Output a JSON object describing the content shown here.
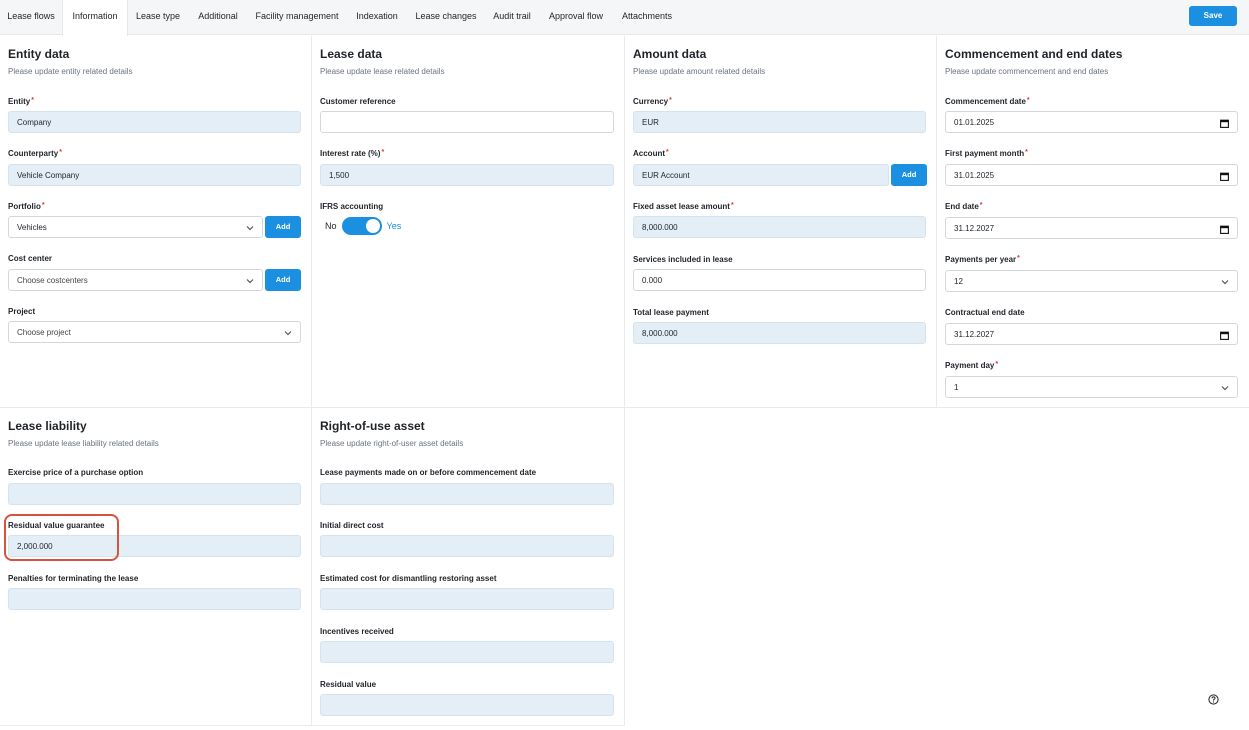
{
  "tabs": [
    "Lease flows",
    "Information",
    "Lease type",
    "Additional",
    "Facility management",
    "Indexation",
    "Lease changes",
    "Audit trail",
    "Approval flow",
    "Attachments"
  ],
  "active_tab": "Information",
  "save_label": "Save",
  "add_label": "Add",
  "entity": {
    "title": "Entity data",
    "subtitle": "Please update entity related details",
    "entity_label": "Entity",
    "entity_value": "Company",
    "counterparty_label": "Counterparty",
    "counterparty_value": "Vehicle Company",
    "portfolio_label": "Portfolio",
    "portfolio_value": "Vehicles",
    "costcenter_label": "Cost center",
    "costcenter_placeholder": "Choose costcenters",
    "project_label": "Project",
    "project_placeholder": "Choose project"
  },
  "lease": {
    "title": "Lease data",
    "subtitle": "Please update lease related details",
    "customer_ref_label": "Customer reference",
    "customer_ref_value": "",
    "interest_label": "Interest rate (%)",
    "interest_value": "1,500",
    "ifrs_label": "IFRS accounting",
    "ifrs_no": "No",
    "ifrs_yes": "Yes"
  },
  "amount": {
    "title": "Amount data",
    "subtitle": "Please update amount related details",
    "currency_label": "Currency",
    "currency_value": "EUR",
    "account_label": "Account",
    "account_value": "EUR Account",
    "fixed_label": "Fixed asset lease amount",
    "fixed_value": "8,000.000",
    "services_label": "Services included in lease",
    "services_value": "0.000",
    "total_label": "Total lease payment",
    "total_value": "8,000.000"
  },
  "dates": {
    "title": "Commencement and end dates",
    "subtitle": "Please update commencement and end dates",
    "commencement_label": "Commencement date",
    "commencement_value": "01.01.2025",
    "first_payment_label": "First payment month",
    "first_payment_value": "31.01.2025",
    "end_label": "End date",
    "end_value": "31.12.2027",
    "ppy_label": "Payments per year",
    "ppy_value": "12",
    "contractual_label": "Contractual end date",
    "contractual_value": "31.12.2027",
    "payday_label": "Payment day",
    "payday_value": "1"
  },
  "liability": {
    "title": "Lease liability",
    "subtitle": "Please update lease liability related details",
    "exercise_label": "Exercise price of a purchase option",
    "exercise_value": "",
    "residual_guarantee_label": "Residual value guarantee",
    "residual_guarantee_value": "2,000.000",
    "penalties_label": "Penalties for terminating the lease",
    "penalties_value": ""
  },
  "rou": {
    "title": "Right-of-use asset",
    "subtitle": "Please update right-of-user asset details",
    "payments_before_label": "Lease payments made on or before commencement date",
    "initial_direct_label": "Initial direct cost",
    "dismantling_label": "Estimated cost for dismantling restoring asset",
    "incentives_label": "Incentives received",
    "residual_label": "Residual value"
  },
  "colors": {
    "accent": "#1b8fe0",
    "readonly_bg": "#e4eef7",
    "highlight": "#d9523b"
  }
}
